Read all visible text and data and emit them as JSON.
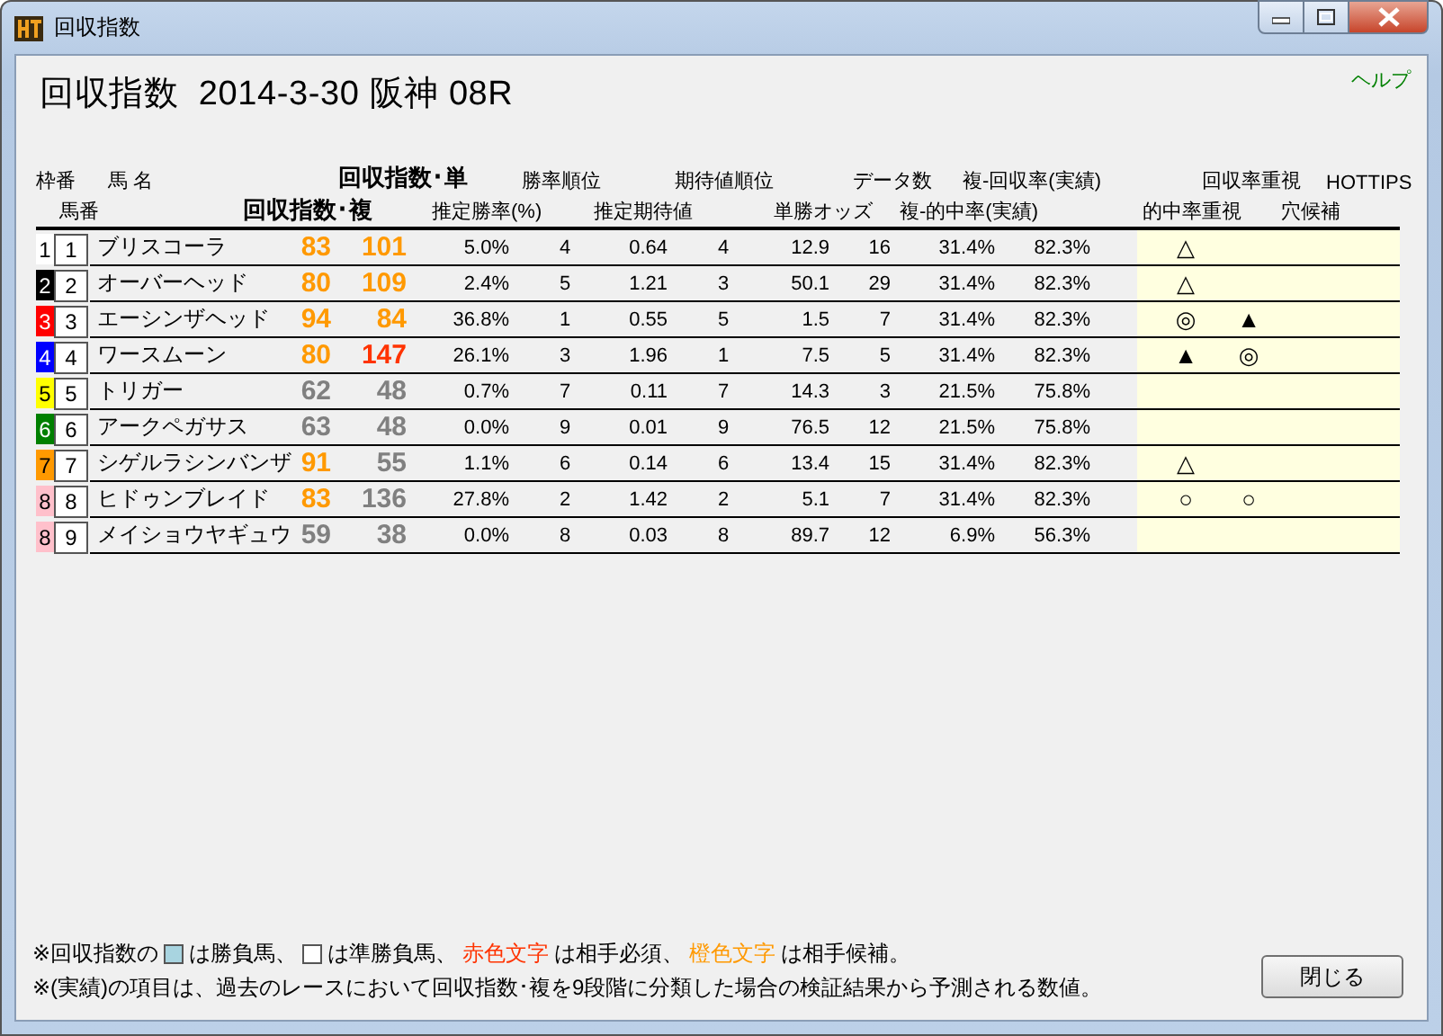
{
  "window": {
    "title": "回収指数"
  },
  "help_link": "ヘルプ",
  "heading": "回収指数  2014-3-30 阪神 08R",
  "header_row_1": [
    "枠番",
    "馬 名",
    "回収指数･単",
    "勝率順位",
    "期待値順位",
    "データ数",
    "複-回収率(実績)",
    "回収率重視",
    "HOTTIPS"
  ],
  "header_row_2": [
    "馬番",
    "回収指数･複",
    "推定勝率(%)",
    "推定期待値",
    "単勝オッズ",
    "複-的中率(実績)",
    "的中率重視",
    "穴候補"
  ],
  "rows": [
    {
      "frame": {
        "text": "1",
        "color": "#ffffff"
      },
      "number": "1",
      "name": "ブリスコーラ",
      "index_single": {
        "text": "83",
        "color": "#ff9900"
      },
      "index_place": {
        "text": "101",
        "color": "#ff9900"
      },
      "win_rate": "5.0%",
      "win_rank": "4",
      "expected": "0.64",
      "expected_rank": "4",
      "odds": "12.9",
      "data_count": "16",
      "place_return": "31.4%",
      "place_hit": "82.3%",
      "mark_1": "△"
    },
    {
      "frame": {
        "text": "2",
        "color": "#000000"
      },
      "number": "2",
      "name": "オーバーヘッド",
      "index_single": {
        "text": "80",
        "color": "#ff9900"
      },
      "index_place": {
        "text": "109",
        "color": "#ff9900"
      },
      "win_rate": "2.4%",
      "win_rank": "5",
      "expected": "1.21",
      "expected_rank": "3",
      "odds": "50.1",
      "data_count": "29",
      "place_return": "31.4%",
      "place_hit": "82.3%",
      "mark_1": "△"
    },
    {
      "frame": {
        "text": "3",
        "color": "#ff0000"
      },
      "number": "3",
      "name": "エーシンザヘッド",
      "index_single": {
        "text": "94",
        "color": "#ff9900"
      },
      "index_place": {
        "text": "84",
        "color": "#ff9900"
      },
      "win_rate": "36.8%",
      "win_rank": "1",
      "expected": "0.55",
      "expected_rank": "5",
      "odds": "1.5",
      "data_count": "7",
      "place_return": "31.4%",
      "place_hit": "82.3%",
      "mark_1": "◎",
      "mark_2": "▲"
    },
    {
      "frame": {
        "text": "4",
        "color": "#0000ff"
      },
      "number": "4",
      "name": "ワースムーン",
      "index_single": {
        "text": "80",
        "color": "#ff9900"
      },
      "index_place": {
        "text": "147",
        "color": "#ff3300"
      },
      "win_rate": "26.1%",
      "win_rank": "3",
      "expected": "1.96",
      "expected_rank": "1",
      "odds": "7.5",
      "data_count": "5",
      "place_return": "31.4%",
      "place_hit": "82.3%",
      "mark_1": "▲",
      "mark_2": "◎"
    },
    {
      "frame": {
        "text": "5",
        "color": "#ffff00"
      },
      "number": "5",
      "name": "トリガー",
      "index_single": {
        "text": "62",
        "color": "#808080"
      },
      "index_place": {
        "text": "48",
        "color": "#808080"
      },
      "win_rate": "0.7%",
      "win_rank": "7",
      "expected": "0.11",
      "expected_rank": "7",
      "odds": "14.3",
      "data_count": "3",
      "place_return": "21.5%",
      "place_hit": "75.8%"
    },
    {
      "frame": {
        "text": "6",
        "color": "#008000"
      },
      "number": "6",
      "name": "アークペガサス",
      "index_single": {
        "text": "63",
        "color": "#808080"
      },
      "index_place": {
        "text": "48",
        "color": "#808080"
      },
      "win_rate": "0.0%",
      "win_rank": "9",
      "expected": "0.01",
      "expected_rank": "9",
      "odds": "76.5",
      "data_count": "12",
      "place_return": "21.5%",
      "place_hit": "75.8%"
    },
    {
      "frame": {
        "text": "7",
        "color": "#ff9900"
      },
      "number": "7",
      "name": "シゲルラシンバンザ",
      "index_single": {
        "text": "91",
        "color": "#ff9900"
      },
      "index_place": {
        "text": "55",
        "color": "#808080"
      },
      "win_rate": "1.1%",
      "win_rank": "6",
      "expected": "0.14",
      "expected_rank": "6",
      "odds": "13.4",
      "data_count": "15",
      "place_return": "31.4%",
      "place_hit": "82.3%",
      "mark_1": "△"
    },
    {
      "frame": {
        "text": "8",
        "color": "#ffc0cb"
      },
      "number": "8",
      "name": "ヒドゥンブレイド",
      "index_single": {
        "text": "83",
        "color": "#ff9900"
      },
      "index_place": {
        "text": "136",
        "color": "#808080"
      },
      "win_rate": "27.8%",
      "win_rank": "2",
      "expected": "1.42",
      "expected_rank": "2",
      "odds": "5.1",
      "data_count": "7",
      "place_return": "31.4%",
      "place_hit": "82.3%",
      "mark_1": "○",
      "mark_2": "○"
    },
    {
      "frame": {
        "text": "8",
        "color": "#ffc0cb"
      },
      "number": "9",
      "name": "メイショウヤギュウ",
      "index_single": {
        "text": "59",
        "color": "#808080"
      },
      "index_place": {
        "text": "38",
        "color": "#808080"
      },
      "win_rate": "0.0%",
      "win_rank": "8",
      "expected": "0.03",
      "expected_rank": "8",
      "odds": "89.7",
      "data_count": "12",
      "place_return": "6.9%",
      "place_hit": "56.3%"
    }
  ],
  "footnote_1": [
    {
      "kind": "text",
      "text": "※回収指数の"
    },
    {
      "kind": "swatch",
      "color": "#a8d4e0"
    },
    {
      "kind": "text",
      "text": "は勝負馬、"
    },
    {
      "kind": "swatch",
      "color": "#ffffff"
    },
    {
      "kind": "text",
      "text": "は準勝負馬、"
    },
    {
      "kind": "text",
      "text": "赤色文字",
      "color": "#ff3300"
    },
    {
      "kind": "text",
      "text": "は相手必須、"
    },
    {
      "kind": "text",
      "text": "橙色文字",
      "color": "#ff9900"
    },
    {
      "kind": "text",
      "text": "は相手候補。"
    }
  ],
  "footnote_2": "※(実績)の項目は、過去のレースにおいて回収指数･複を9段階に分類した場合の検証結果から予測される数値。",
  "close_button": "閉じる"
}
